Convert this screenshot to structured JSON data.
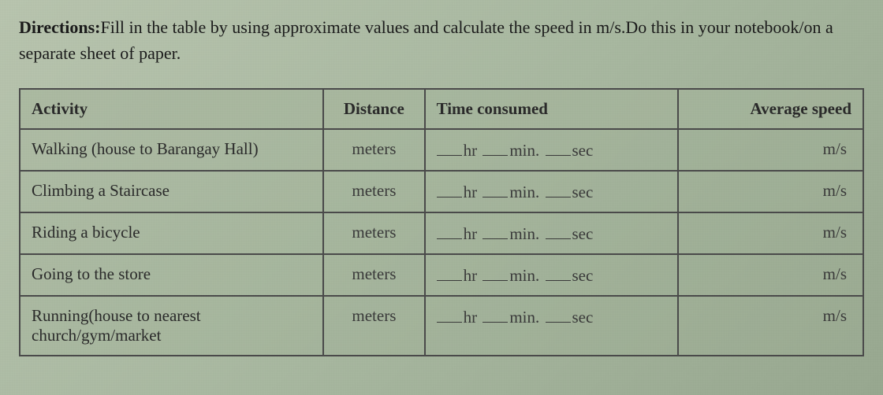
{
  "directions": {
    "label": "Directions:",
    "text": "Fill in the table by using approximate values and calculate  the speed in m/s.Do this in your notebook/on a separate sheet of paper."
  },
  "table": {
    "headers": {
      "activity": "Activity",
      "distance": "Distance",
      "time": "Time consumed",
      "speed": "Average speed"
    },
    "units": {
      "distance": "meters",
      "hr": "hr",
      "min": "min.",
      "sec": "sec",
      "speed": "m/s"
    },
    "rows": [
      {
        "activity": "Walking (house to Barangay Hall)"
      },
      {
        "activity": "Climbing a Staircase"
      },
      {
        "activity": "Riding a bicycle"
      },
      {
        "activity": "Going to the store"
      },
      {
        "activity": "Running(house to nearest church/gym/market"
      }
    ]
  }
}
